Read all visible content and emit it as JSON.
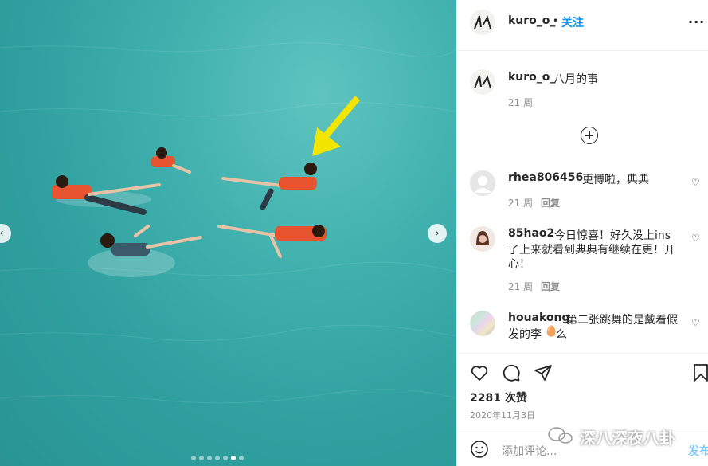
{
  "post": {
    "username": "kuro_o_",
    "dot": "•",
    "follow_label": "关注",
    "more_label": "..."
  },
  "caption": {
    "username": "kuro_o_",
    "text": "八月的事",
    "time": "21 周"
  },
  "comments": [
    {
      "username": "rhea806456",
      "text": "更博啦，典典",
      "time": "21 周",
      "reply_label": "回复"
    },
    {
      "username": "85hao2",
      "text_line1": "今日惊喜！好久没上ins",
      "text_line2": "了上来就看到典典有继续在更！开",
      "text_line3": "心！",
      "time": "21 周",
      "reply_label": "回复"
    },
    {
      "username": "houakong",
      "text_line1": "第二张跳舞的是戴着假",
      "text_line2": "发的李",
      "text_line2_tail": "么"
    }
  ],
  "likes": "2281 次赞",
  "date": "2020年11月3日",
  "comment_input": {
    "placeholder": "添加评论...",
    "post_label": "发布"
  },
  "watermark": "深八深夜八卦",
  "carousel": {
    "count": 7,
    "active_index": 5
  },
  "colors": {
    "accent": "#0095f6",
    "arrow": "#f2e600",
    "water": "#3fb0ad"
  }
}
